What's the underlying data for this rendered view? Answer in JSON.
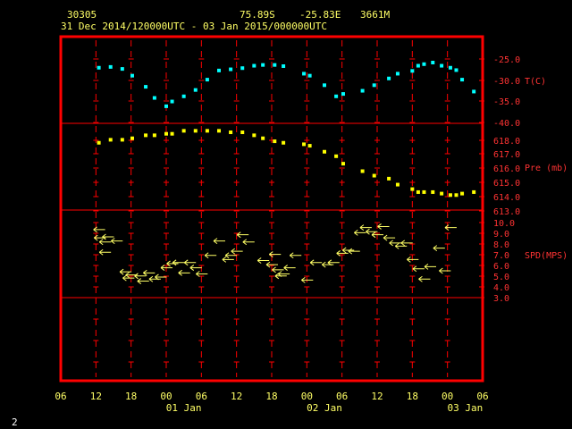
{
  "header": {
    "station_id": "30305",
    "lat": "75.89S",
    "lon": "-25.83E",
    "elevation": "3661M",
    "time_range": "31 Dec 2014/120000UTC - 03 Jan 2015/000000UTC"
  },
  "footer": {
    "page_number": "2"
  },
  "colors": {
    "frame": "#ff0000",
    "grid": "#ff0000",
    "temperature": "#00ffff",
    "pressure": "#ffff00",
    "wind": "#ffff66",
    "axis_text_right": "#ff3333",
    "axis_text_bottom": "#ffff66"
  },
  "chart_data": {
    "type": "scatter",
    "x_axis": {
      "unit": "hours since 31 Dec 2014 06 UTC",
      "range_hours": [
        0,
        72
      ],
      "tick_labels": [
        "06",
        "12",
        "18",
        "00",
        "06",
        "12",
        "18",
        "00",
        "06",
        "12",
        "18",
        "00",
        "06"
      ],
      "day_labels": [
        "01 Jan",
        "02 Jan",
        "03 Jan"
      ]
    },
    "panels": [
      {
        "name": "temperature",
        "label": "T(C)",
        "ylim": [
          -40,
          -22
        ],
        "tick_labels": [
          "-25.0",
          "-30.0",
          "-35.0",
          "-40.0"
        ],
        "points": [
          [
            6.5,
            -26.0
          ],
          [
            8.5,
            -25.8
          ],
          [
            10.5,
            -26.3
          ],
          [
            12.2,
            -28.0
          ],
          [
            14.5,
            -30.8
          ],
          [
            16,
            -33.6
          ],
          [
            18,
            -35.7
          ],
          [
            19,
            -34.5
          ],
          [
            21,
            -33.2
          ],
          [
            23,
            -31.6
          ],
          [
            25,
            -29.0
          ],
          [
            27,
            -26.7
          ],
          [
            29,
            -26.4
          ],
          [
            31,
            -26.1
          ],
          [
            33,
            -25.5
          ],
          [
            34.5,
            -25.3
          ],
          [
            36.5,
            -25.3
          ],
          [
            38,
            -25.6
          ],
          [
            41.5,
            -27.5
          ],
          [
            42.5,
            -28.0
          ],
          [
            45,
            -30.4
          ],
          [
            47,
            -33.2
          ],
          [
            48.2,
            -32.6
          ],
          [
            51.5,
            -31.8
          ],
          [
            53.5,
            -30.4
          ],
          [
            56,
            -28.7
          ],
          [
            57.5,
            -27.5
          ],
          [
            60,
            -26.8
          ],
          [
            61,
            -25.5
          ],
          [
            62,
            -25.1
          ],
          [
            63.5,
            -24.7
          ],
          [
            65,
            -25.5
          ],
          [
            66.5,
            -26.0
          ],
          [
            67.5,
            -26.6
          ],
          [
            68.5,
            -29.0
          ],
          [
            70.5,
            -32.0
          ]
        ]
      },
      {
        "name": "pressure",
        "label": "Pre (mb)",
        "ylim": [
          612.6,
          618.4
        ],
        "tick_labels": [
          "618.0",
          "617.0",
          "616.0",
          "615.0",
          "614.0",
          "613.0"
        ],
        "points": [
          [
            6.5,
            617.1
          ],
          [
            8.5,
            617.3
          ],
          [
            10.5,
            617.3
          ],
          [
            12.2,
            617.4
          ],
          [
            14.5,
            617.6
          ],
          [
            16,
            617.6
          ],
          [
            18,
            617.7
          ],
          [
            19,
            617.7
          ],
          [
            21,
            617.9
          ],
          [
            23,
            617.9
          ],
          [
            25,
            617.9
          ],
          [
            27,
            617.9
          ],
          [
            29,
            617.8
          ],
          [
            31,
            617.8
          ],
          [
            33,
            617.6
          ],
          [
            34.5,
            617.4
          ],
          [
            36.5,
            617.2
          ],
          [
            38,
            617.1
          ],
          [
            41.5,
            617.0
          ],
          [
            42.5,
            616.9
          ],
          [
            45,
            616.5
          ],
          [
            47,
            616.2
          ],
          [
            48.2,
            615.7
          ],
          [
            51.5,
            615.2
          ],
          [
            53.5,
            614.9
          ],
          [
            56,
            614.7
          ],
          [
            57.5,
            614.3
          ],
          [
            60,
            614.0
          ],
          [
            61,
            613.8
          ],
          [
            62,
            613.8
          ],
          [
            63.5,
            613.8
          ],
          [
            65,
            613.7
          ],
          [
            66.5,
            613.6
          ],
          [
            67.5,
            613.6
          ],
          [
            68.5,
            613.7
          ],
          [
            70.5,
            613.8
          ]
        ]
      },
      {
        "name": "wind_speed",
        "label": "SPD(MPS)",
        "ylim": [
          2.5,
          11
        ],
        "tick_labels": [
          "10.0",
          "9.0",
          "8.0",
          "7.0",
          "6.0",
          "5.0",
          "4.0",
          "3.0"
        ],
        "points": [
          [
            6.5,
            9.1
          ],
          [
            6.6,
            8.3
          ],
          [
            7.5,
            7.9
          ],
          [
            8,
            8.4
          ],
          [
            9.5,
            8.0
          ],
          [
            7.5,
            6.9
          ],
          [
            11,
            5.0
          ],
          [
            11.5,
            4.4
          ],
          [
            12,
            4.7
          ],
          [
            13.5,
            4.6
          ],
          [
            14,
            4.1
          ],
          [
            15,
            4.9
          ],
          [
            16,
            4.3
          ],
          [
            17,
            4.5
          ],
          [
            18,
            5.4
          ],
          [
            19,
            5.8
          ],
          [
            20,
            5.9
          ],
          [
            21,
            4.9
          ],
          [
            22,
            5.9
          ],
          [
            23,
            5.4
          ],
          [
            24,
            4.8
          ],
          [
            25.5,
            6.6
          ],
          [
            27,
            8.0
          ],
          [
            28.5,
            6.2
          ],
          [
            29,
            6.6
          ],
          [
            30,
            7.0
          ],
          [
            31,
            8.6
          ],
          [
            32,
            7.9
          ],
          [
            34.5,
            6.1
          ],
          [
            36,
            5.7
          ],
          [
            36.5,
            6.7
          ],
          [
            37,
            5.2
          ],
          [
            37.5,
            4.6
          ],
          [
            38,
            4.8
          ],
          [
            39,
            5.4
          ],
          [
            40,
            6.6
          ],
          [
            42,
            4.2
          ],
          [
            43.5,
            5.9
          ],
          [
            45.5,
            5.7
          ],
          [
            46.5,
            5.9
          ],
          [
            48,
            6.8
          ],
          [
            49,
            7.1
          ],
          [
            50,
            7.0
          ],
          [
            51,
            8.8
          ],
          [
            52,
            9.3
          ],
          [
            53,
            8.9
          ],
          [
            54,
            8.6
          ],
          [
            55,
            9.4
          ],
          [
            56,
            8.3
          ],
          [
            57,
            7.8
          ],
          [
            58,
            7.5
          ],
          [
            59,
            7.8
          ],
          [
            60,
            6.2
          ],
          [
            61,
            5.3
          ],
          [
            62,
            4.3
          ],
          [
            63,
            5.5
          ],
          [
            64.5,
            7.3
          ],
          [
            65.5,
            5.1
          ],
          [
            66.5,
            9.3
          ]
        ]
      }
    ]
  }
}
